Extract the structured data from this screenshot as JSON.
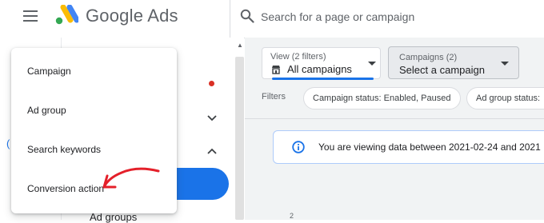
{
  "header": {
    "brand": "Google Ads",
    "search_placeholder": "Search for a page or campaign",
    "icons": [
      "menu-icon",
      "google-ads-logo",
      "search-icon"
    ]
  },
  "left_nav": {
    "visible_label": "Ad groups",
    "active_item_color": "#1a73e8",
    "dot_color": "#d93025",
    "icons": [
      "chevron-down-icon",
      "chevron-up-icon",
      "scroll-up-icon"
    ]
  },
  "dropdown_menu": {
    "items": [
      "Campaign",
      "Ad group",
      "Search keywords",
      "Conversion action"
    ],
    "annotation_color": "#e4202a"
  },
  "filters": {
    "view_filter": {
      "label": "View (2 filters)",
      "value": "All campaigns",
      "icon": "store-icon"
    },
    "campaign_filter": {
      "label": "Campaigns (2)",
      "value": "Select a campaign"
    },
    "filters_label": "Filters",
    "chips": [
      "Campaign status: Enabled, Paused",
      "Ad group status:"
    ]
  },
  "info_banner": {
    "text": "You are viewing data between 2021-02-24 and 2021",
    "icon": "info-icon",
    "accent": "#1a73e8"
  },
  "chart_tick": "2"
}
